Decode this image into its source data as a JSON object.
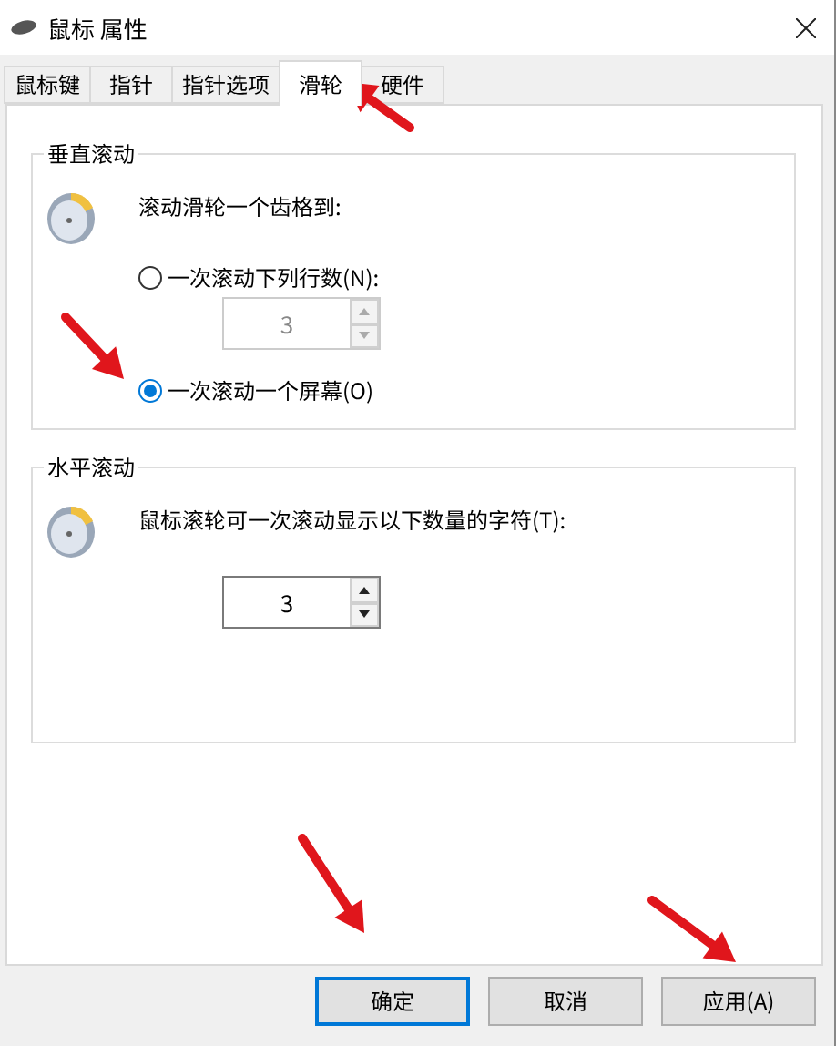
{
  "window": {
    "title": "鼠标 属性"
  },
  "tabs": [
    {
      "label": "鼠标键",
      "selected": false
    },
    {
      "label": "指针",
      "selected": false
    },
    {
      "label": "指针选项",
      "selected": false
    },
    {
      "label": "滑轮",
      "selected": true
    },
    {
      "label": "硬件",
      "selected": false
    }
  ],
  "groups": [
    {
      "title": "垂直滚动",
      "prompt": "滚动滑轮一个齿格到:",
      "options": [
        {
          "kind": "radio",
          "label": "一次滚动下列行数(N):",
          "selected": false
        },
        {
          "kind": "spinner",
          "value": "3",
          "disabled": true
        },
        {
          "kind": "radio",
          "label": "一次滚动一个屏幕(O)",
          "selected": true
        }
      ]
    },
    {
      "title": "水平滚动",
      "prompt": "鼠标滚轮可一次滚动显示以下数量的字符(T):",
      "options": [
        {
          "kind": "spinner",
          "value": "3",
          "disabled": false
        }
      ]
    }
  ],
  "buttons": [
    {
      "label": "确定",
      "focused": true
    },
    {
      "label": "取消",
      "focused": false
    },
    {
      "label": "应用(A)",
      "focused": false
    }
  ]
}
